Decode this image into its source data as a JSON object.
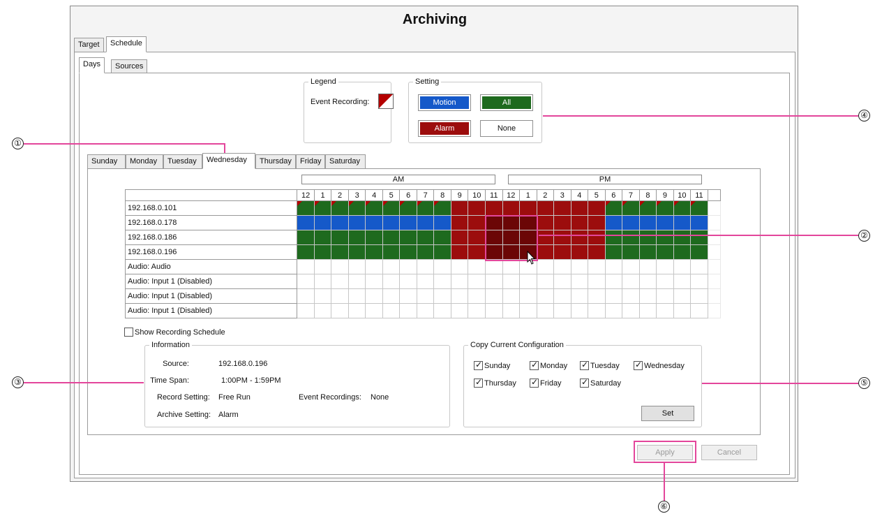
{
  "window": {
    "title": "Archiving"
  },
  "top_tabs": [
    {
      "label": "Target"
    },
    {
      "label": "Schedule"
    }
  ],
  "sub_tabs": [
    {
      "label": "Days"
    },
    {
      "label": "Sources"
    }
  ],
  "legend": {
    "title": "Legend",
    "event_recording_label": "Event Recording:"
  },
  "setting": {
    "title": "Setting",
    "motion": "Motion",
    "all": "All",
    "alarm": "Alarm",
    "none": "None"
  },
  "colors": {
    "motion": "#1559c9",
    "all": "#1e6a1e",
    "alarm": "#9c0d0d",
    "none": "#ffffff",
    "highlight": "#e3469b"
  },
  "day_tabs": [
    "Sunday",
    "Monday",
    "Tuesday",
    "Wednesday",
    "Thursday",
    "Friday",
    "Saturday"
  ],
  "active_day": "Wednesday",
  "schedule": {
    "am_label": "AM",
    "pm_label": "PM",
    "hours": [
      "12",
      "1",
      "2",
      "3",
      "4",
      "5",
      "6",
      "7",
      "8",
      "9",
      "10",
      "11",
      "12",
      "1",
      "2",
      "3",
      "4",
      "5",
      "6",
      "7",
      "8",
      "9",
      "10",
      "11"
    ],
    "rows": [
      {
        "name": "192.168.0.101",
        "cells": "gggggggggrrrrrrrrrgggggg",
        "events": [
          0,
          1,
          2,
          3,
          4,
          5,
          6,
          7,
          8,
          18,
          19,
          20,
          21,
          22,
          23
        ]
      },
      {
        "name": "192.168.0.178",
        "cells": "bbbbbbbbbrrrrrrrrrbbbbbb",
        "events": []
      },
      {
        "name": "192.168.0.186",
        "cells": "gggggggggrrrrrrrrrgggggg",
        "events": []
      },
      {
        "name": "192.168.0.196",
        "cells": "gggggggggrrrrrrrrrgggggg",
        "events": []
      },
      {
        "name": "Audio: Audio",
        "cells": "wwwwwwwwwwwwwwwwwwwwwwww",
        "events": []
      },
      {
        "name": "Audio: Input 1 (Disabled)",
        "cells": "wwwwwwwwwwwwwwwwwwwwwwww",
        "events": []
      },
      {
        "name": "Audio: Input 1 (Disabled)",
        "cells": "wwwwwwwwwwwwwwwwwwwwwwww",
        "events": []
      },
      {
        "name": "Audio: Input 1 (Disabled)",
        "cells": "wwwwwwwwwwwwwwwwwwwwwwww",
        "events": []
      }
    ],
    "selection": {
      "rows": [
        1,
        2,
        3
      ],
      "hours": [
        11,
        12,
        13
      ]
    }
  },
  "show_recording_schedule": {
    "label": "Show Recording Schedule",
    "checked": false
  },
  "information": {
    "title": "Information",
    "source_label": "Source:",
    "source_value": "192.168.0.196",
    "timespan_label": "Time Span:",
    "timespan_value": "1:00PM - 1:59PM",
    "record_setting_label": "Record Setting:",
    "record_setting_value": "Free Run",
    "event_recordings_label": "Event Recordings:",
    "event_recordings_value": "None",
    "archive_setting_label": "Archive Setting:",
    "archive_setting_value": "Alarm"
  },
  "copy_config": {
    "title": "Copy Current Configuration",
    "days": [
      {
        "label": "Sunday",
        "checked": true
      },
      {
        "label": "Monday",
        "checked": true
      },
      {
        "label": "Tuesday",
        "checked": true
      },
      {
        "label": "Wednesday",
        "checked": true
      },
      {
        "label": "Thursday",
        "checked": true
      },
      {
        "label": "Friday",
        "checked": true
      },
      {
        "label": "Saturday",
        "checked": true
      }
    ],
    "set_label": "Set"
  },
  "footer": {
    "apply_label": "Apply",
    "cancel_label": "Cancel"
  },
  "callouts": [
    "①",
    "②",
    "③",
    "④",
    "⑤",
    "⑥"
  ]
}
